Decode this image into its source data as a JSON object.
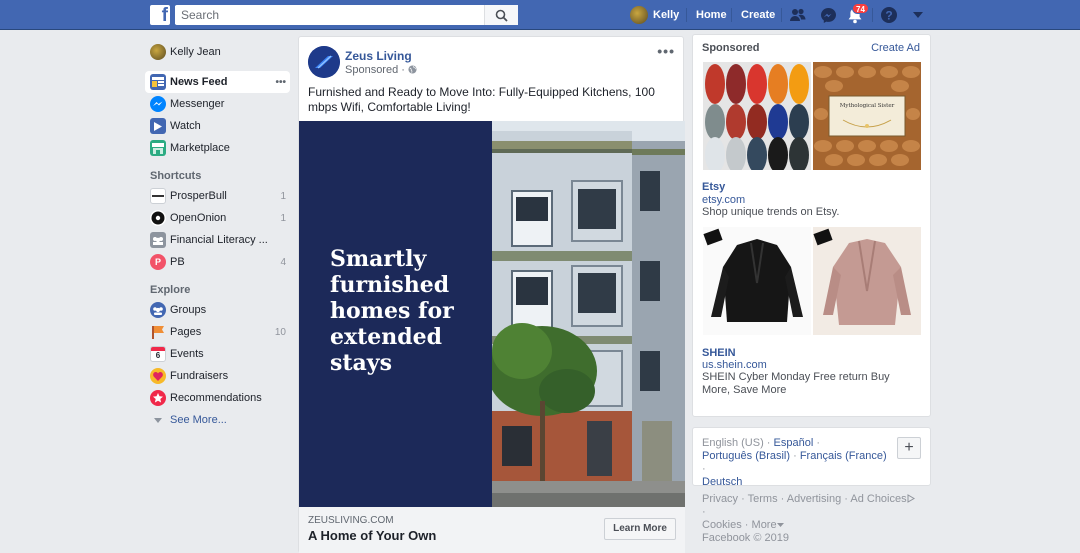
{
  "topbar": {
    "logo": "f",
    "search_placeholder": "Search",
    "user_name": "Kelly",
    "home": "Home",
    "create": "Create",
    "notifications_count": "74"
  },
  "left": {
    "profile_name": "Kelly Jean",
    "main_items": [
      {
        "label": "News Feed"
      },
      {
        "label": "Messenger"
      },
      {
        "label": "Watch"
      },
      {
        "label": "Marketplace"
      }
    ],
    "more_dots": "•••",
    "shortcuts_heading": "Shortcuts",
    "shortcuts": [
      {
        "label": "ProsperBull",
        "count": "1"
      },
      {
        "label": "OpenOnion",
        "count": "1"
      },
      {
        "label": "Financial Literacy ...",
        "count": ""
      },
      {
        "label": "PB",
        "count": "4",
        "initial": "P"
      }
    ],
    "explore_heading": "Explore",
    "explore": [
      {
        "label": "Groups",
        "count": ""
      },
      {
        "label": "Pages",
        "count": "10"
      },
      {
        "label": "Events",
        "count": "",
        "day": "6"
      },
      {
        "label": "Fundraisers",
        "count": ""
      },
      {
        "label": "Recommendations",
        "count": ""
      }
    ],
    "see_more": "See More..."
  },
  "post": {
    "page_name": "Zeus Living",
    "sponsored": "Sponsored",
    "menu": "•••",
    "text": "Furnished and Ready to Move Into: Fully-Equipped Kitchens, 100 mbps Wifi, Comfortable Living!",
    "ad_headline": "Smartly furnished homes for extended stays",
    "domain": "ZEUSLIVING.COM",
    "cta_title": "A Home of Your Own",
    "cta_button": "Learn More"
  },
  "sidebar_ads": {
    "heading": "Sponsored",
    "create_ad": "Create Ad",
    "ads": [
      {
        "name": "Etsy",
        "url": "etsy.com",
        "desc": "Shop unique trends on Etsy.",
        "card_text": "Mythological Sister"
      },
      {
        "name": "SHEIN",
        "url": "us.shein.com",
        "desc": "SHEIN Cyber Monday Free return Buy More, Save More"
      }
    ]
  },
  "languages": {
    "current": "English (US)",
    "options": [
      "Español",
      "Português (Brasil)",
      "Français (France)",
      "Deutsch"
    ],
    "sep": " · ",
    "add_button": "+"
  },
  "footer": {
    "links": [
      "Privacy",
      "Terms",
      "Advertising",
      "Ad Choices",
      "Cookies",
      "More"
    ],
    "copyright": "Facebook © 2019"
  },
  "colors": {
    "brand": "#4267b2",
    "link": "#365899",
    "badge": "#fa3e3e",
    "ad_navy": "#1c2959"
  }
}
